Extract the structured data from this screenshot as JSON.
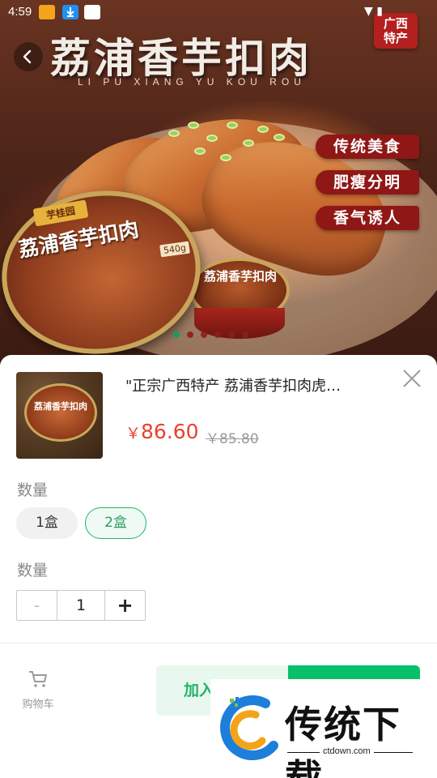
{
  "status_bar": {
    "time": "4:59"
  },
  "hero": {
    "title": "荔浦香芋扣肉",
    "subtitle": "LI PU XIANG YU KOU ROU",
    "region_badge_line1": "广西",
    "region_badge_line2": "特产",
    "features": [
      "传统美食",
      "肥瘦分明",
      "香气诱人"
    ],
    "tin_brand": "芋桂园",
    "tin_title": "荔浦香芋扣肉",
    "tin_weight": "540g",
    "tin2_title": "荔浦香芋扣肉",
    "carousel": {
      "count": 6,
      "active_index": 0,
      "active_color": "#1a9b5e"
    }
  },
  "product": {
    "name": "\"正宗广西特产 荔浦香芋扣肉虎…",
    "price_symbol": "￥",
    "price": "86.60",
    "original_price": "￥85.80"
  },
  "spec_section": {
    "label": "数量",
    "options": [
      "1盒",
      "2盒"
    ],
    "selected": "2盒"
  },
  "quantity_section": {
    "label": "数量",
    "minus": "-",
    "value": "1",
    "plus": "+"
  },
  "footer": {
    "cart_label": "购物车",
    "add_to_cart_label": "加入",
    "accent_color": "#08c069"
  },
  "watermark": {
    "brand": "传统下载",
    "url": "ctdown.com"
  }
}
